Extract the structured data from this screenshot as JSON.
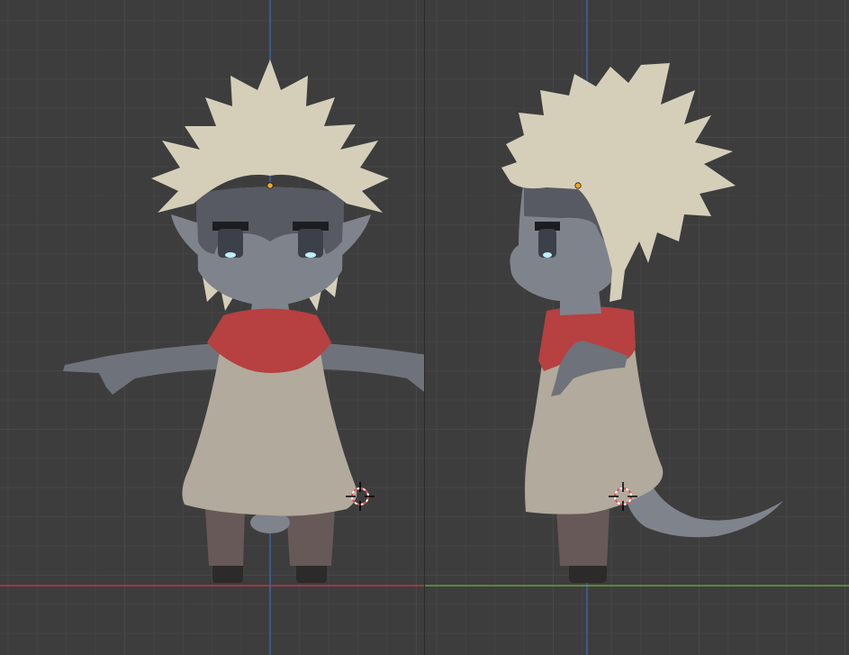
{
  "viewports": [
    {
      "view": "front",
      "axes": {
        "vertical": "Z",
        "horizontal": "X"
      },
      "character": "chibi-elf"
    },
    {
      "view": "right",
      "axes": {
        "vertical": "Z",
        "horizontal": "Y"
      },
      "character": "chibi-elf"
    }
  ],
  "colors": {
    "background": "#3d3d3d",
    "grid_minor": "#444444",
    "grid_major": "#474747",
    "axis_x": "#b53b49",
    "axis_y": "#6d9b3a",
    "axis_z": "#3a63a8",
    "hair": "#d5cfba",
    "skin": "#7f838c",
    "skin_dark": "#575a62",
    "scarf": "#b74040",
    "tunic": "#b2aa9c",
    "pants": "#665958",
    "boots": "#2d2a2a",
    "eye_glow": "#bfeeff",
    "origin_dot": "#f5a623"
  },
  "icons": [
    "3d-cursor-icon",
    "object-origin-icon"
  ]
}
